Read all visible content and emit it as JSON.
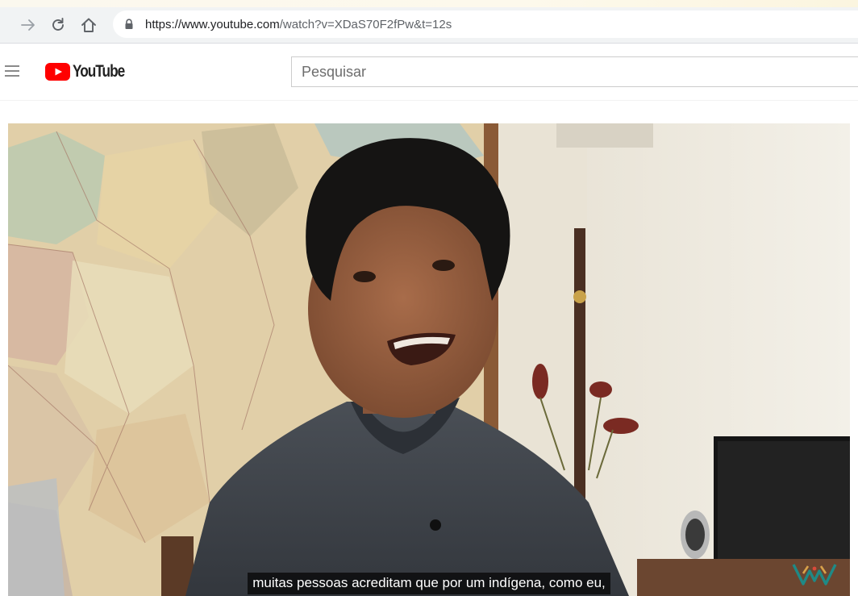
{
  "browser": {
    "url_host": "https://www.youtube.com",
    "url_path": "/watch?v=XDaS70F2fPw&t=12s",
    "icons": [
      "forward-icon",
      "reload-icon",
      "home-icon",
      "lock-icon"
    ]
  },
  "header": {
    "logo_text": "YouTube",
    "search_placeholder": "Pesquisar",
    "icons": [
      "menu-icon",
      "youtube-play-icon"
    ]
  },
  "player": {
    "subtitle": "muitas pessoas acreditam que por um indígena, como eu,",
    "watermark_icon": "channel-watermark-icon"
  },
  "colors": {
    "brand_red": "#ff0000",
    "subtitle_bg": "#080808",
    "browser_chrome": "#f1f3f4"
  }
}
